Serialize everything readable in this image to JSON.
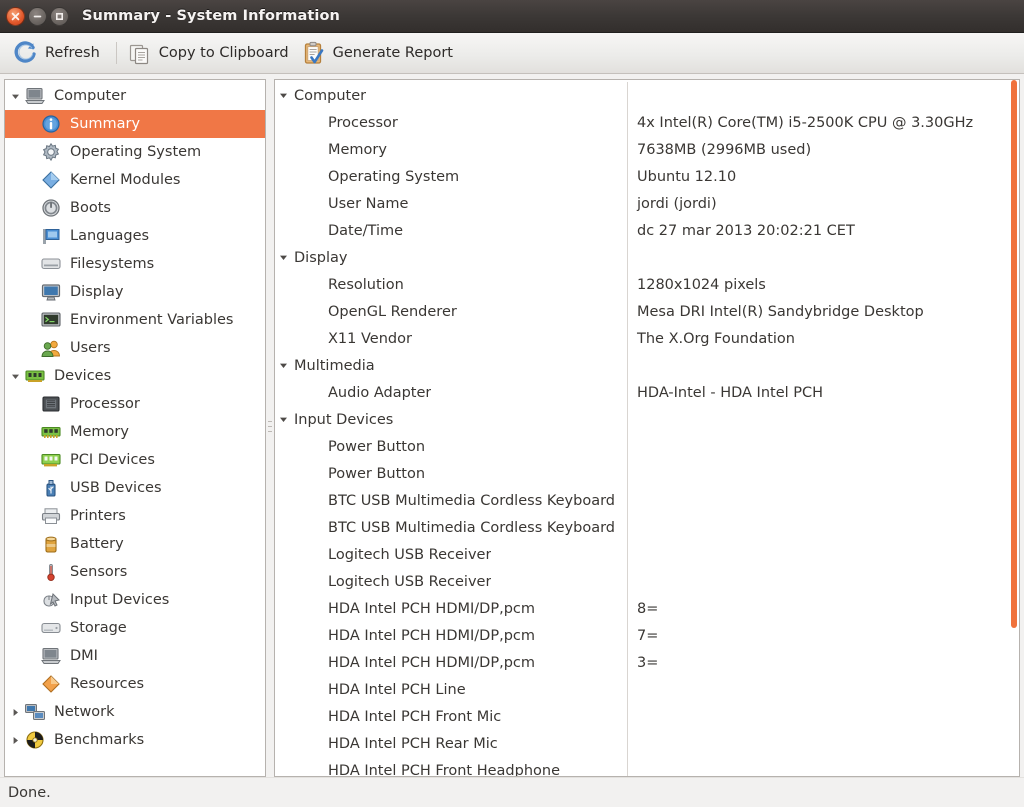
{
  "window": {
    "title": "Summary - System Information",
    "buttons": {
      "close": "close-button",
      "minimize": "minimize-button",
      "maximize": "maximize-button"
    }
  },
  "toolbar": {
    "refresh_label": "Refresh",
    "copy_label": "Copy to Clipboard",
    "report_label": "Generate Report"
  },
  "sidebar": {
    "items": [
      {
        "label": "Computer",
        "level": 0,
        "icon": "computer-icon",
        "expander": "down",
        "selected": false
      },
      {
        "label": "Summary",
        "level": 1,
        "icon": "info-icon",
        "expander": "none",
        "selected": true
      },
      {
        "label": "Operating System",
        "level": 1,
        "icon": "gear-icon",
        "expander": "none",
        "selected": false
      },
      {
        "label": "Kernel Modules",
        "level": 1,
        "icon": "diamond-blue-icon",
        "expander": "none",
        "selected": false
      },
      {
        "label": "Boots",
        "level": 1,
        "icon": "power-icon",
        "expander": "none",
        "selected": false
      },
      {
        "label": "Languages",
        "level": 1,
        "icon": "flag-icon",
        "expander": "none",
        "selected": false
      },
      {
        "label": "Filesystems",
        "level": 1,
        "icon": "drive-icon",
        "expander": "none",
        "selected": false
      },
      {
        "label": "Display",
        "level": 1,
        "icon": "monitor-icon",
        "expander": "none",
        "selected": false
      },
      {
        "label": "Environment Variables",
        "level": 1,
        "icon": "terminal-icon",
        "expander": "none",
        "selected": false
      },
      {
        "label": "Users",
        "level": 1,
        "icon": "users-icon",
        "expander": "none",
        "selected": false
      },
      {
        "label": "Devices",
        "level": 0,
        "icon": "devices-icon",
        "expander": "down",
        "selected": false
      },
      {
        "label": "Processor",
        "level": 1,
        "icon": "cpu-icon",
        "expander": "none",
        "selected": false
      },
      {
        "label": "Memory",
        "level": 1,
        "icon": "memory-icon",
        "expander": "none",
        "selected": false
      },
      {
        "label": "PCI Devices",
        "level": 1,
        "icon": "pci-card-icon",
        "expander": "none",
        "selected": false
      },
      {
        "label": "USB Devices",
        "level": 1,
        "icon": "usb-icon",
        "expander": "none",
        "selected": false
      },
      {
        "label": "Printers",
        "level": 1,
        "icon": "printer-icon",
        "expander": "none",
        "selected": false
      },
      {
        "label": "Battery",
        "level": 1,
        "icon": "battery-icon",
        "expander": "none",
        "selected": false
      },
      {
        "label": "Sensors",
        "level": 1,
        "icon": "thermometer-icon",
        "expander": "none",
        "selected": false
      },
      {
        "label": "Input Devices",
        "level": 1,
        "icon": "mouse-icon",
        "expander": "none",
        "selected": false
      },
      {
        "label": "Storage",
        "level": 1,
        "icon": "harddisk-icon",
        "expander": "none",
        "selected": false
      },
      {
        "label": "DMI",
        "level": 1,
        "icon": "computer-icon",
        "expander": "none",
        "selected": false
      },
      {
        "label": "Resources",
        "level": 1,
        "icon": "diamond-orange-icon",
        "expander": "none",
        "selected": false
      },
      {
        "label": "Network",
        "level": 0,
        "icon": "network-icon",
        "expander": "right",
        "selected": false
      },
      {
        "label": "Benchmarks",
        "level": 0,
        "icon": "benchmark-icon",
        "expander": "right",
        "selected": false
      }
    ]
  },
  "detail": {
    "rows": [
      {
        "group": true,
        "key": "Computer",
        "value": "",
        "expander": "down"
      },
      {
        "group": false,
        "key": "Processor",
        "value": "4x Intel(R) Core(TM) i5-2500K CPU @ 3.30GHz"
      },
      {
        "group": false,
        "key": "Memory",
        "value": "7638MB (2996MB used)"
      },
      {
        "group": false,
        "key": "Operating System",
        "value": "Ubuntu 12.10"
      },
      {
        "group": false,
        "key": "User Name",
        "value": "jordi (jordi)"
      },
      {
        "group": false,
        "key": "Date/Time",
        "value": "dc 27 mar 2013 20:02:21 CET"
      },
      {
        "group": true,
        "key": "Display",
        "value": "",
        "expander": "down"
      },
      {
        "group": false,
        "key": "Resolution",
        "value": "1280x1024 pixels"
      },
      {
        "group": false,
        "key": "OpenGL Renderer",
        "value": "Mesa DRI Intel(R) Sandybridge Desktop"
      },
      {
        "group": false,
        "key": "X11 Vendor",
        "value": "The X.Org Foundation"
      },
      {
        "group": true,
        "key": "Multimedia",
        "value": "",
        "expander": "down"
      },
      {
        "group": false,
        "key": "Audio Adapter",
        "value": "HDA-Intel - HDA Intel PCH"
      },
      {
        "group": true,
        "key": "Input Devices",
        "value": "",
        "expander": "down"
      },
      {
        "group": false,
        "key": "Power Button",
        "value": ""
      },
      {
        "group": false,
        "key": "Power Button",
        "value": ""
      },
      {
        "group": false,
        "key": "BTC USB Multimedia Cordless Keyboard",
        "value": ""
      },
      {
        "group": false,
        "key": "BTC USB Multimedia Cordless Keyboard",
        "value": ""
      },
      {
        "group": false,
        "key": "Logitech USB Receiver",
        "value": ""
      },
      {
        "group": false,
        "key": "Logitech USB Receiver",
        "value": ""
      },
      {
        "group": false,
        "key": "HDA Intel PCH HDMI/DP,pcm",
        "value": "8="
      },
      {
        "group": false,
        "key": "HDA Intel PCH HDMI/DP,pcm",
        "value": "7="
      },
      {
        "group": false,
        "key": "HDA Intel PCH HDMI/DP,pcm",
        "value": "3="
      },
      {
        "group": false,
        "key": "HDA Intel PCH Line",
        "value": ""
      },
      {
        "group": false,
        "key": "HDA Intel PCH Front Mic",
        "value": ""
      },
      {
        "group": false,
        "key": "HDA Intel PCH Rear Mic",
        "value": ""
      },
      {
        "group": false,
        "key": "HDA Intel PCH Front Headphone",
        "value": ""
      }
    ]
  },
  "statusbar": {
    "text": "Done."
  },
  "colors": {
    "selection": "#f07746",
    "scrollbar_thumb": "#f0723c",
    "titlebar": "#3c3836",
    "pane_background": "#ffffff",
    "window_background": "#f2f1f0",
    "text": "#3a3734"
  }
}
